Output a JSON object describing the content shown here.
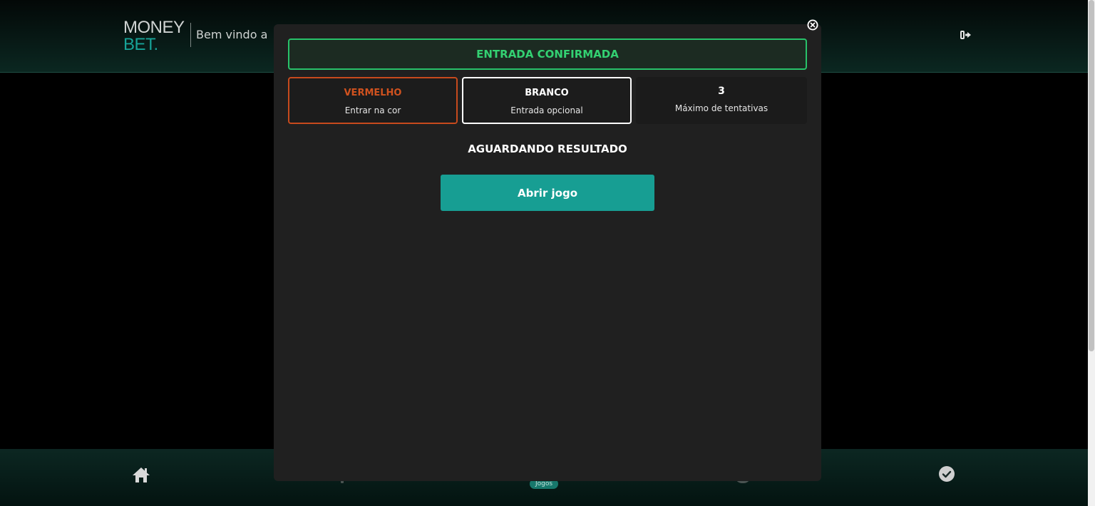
{
  "header": {
    "logo_line1": "MONEY",
    "logo_line2": "BET.",
    "welcome_text": "Bem vindo a",
    "logout_icon": "logout-icon"
  },
  "modal": {
    "close_icon": "close-circle-icon",
    "status": "ENTRADA CONFIRMADA",
    "cards": [
      {
        "title": "VERMELHO",
        "subtitle": "Entrar na cor"
      },
      {
        "title": "BRANCO",
        "subtitle": "Entrada opcional"
      },
      {
        "title": "3",
        "subtitle": "Máximo de tentativas"
      }
    ],
    "waiting_text": "AGUARDANDO RESULTADO",
    "open_game_label": "Abrir jogo"
  },
  "bottom_nav": {
    "home_icon": "home-icon",
    "games_label": "Jogos",
    "check_icon": "check-circle-icon"
  },
  "colors": {
    "accent": "#179e93",
    "success": "#33d172",
    "red": "#d0521f",
    "modal_bg": "#202020"
  }
}
